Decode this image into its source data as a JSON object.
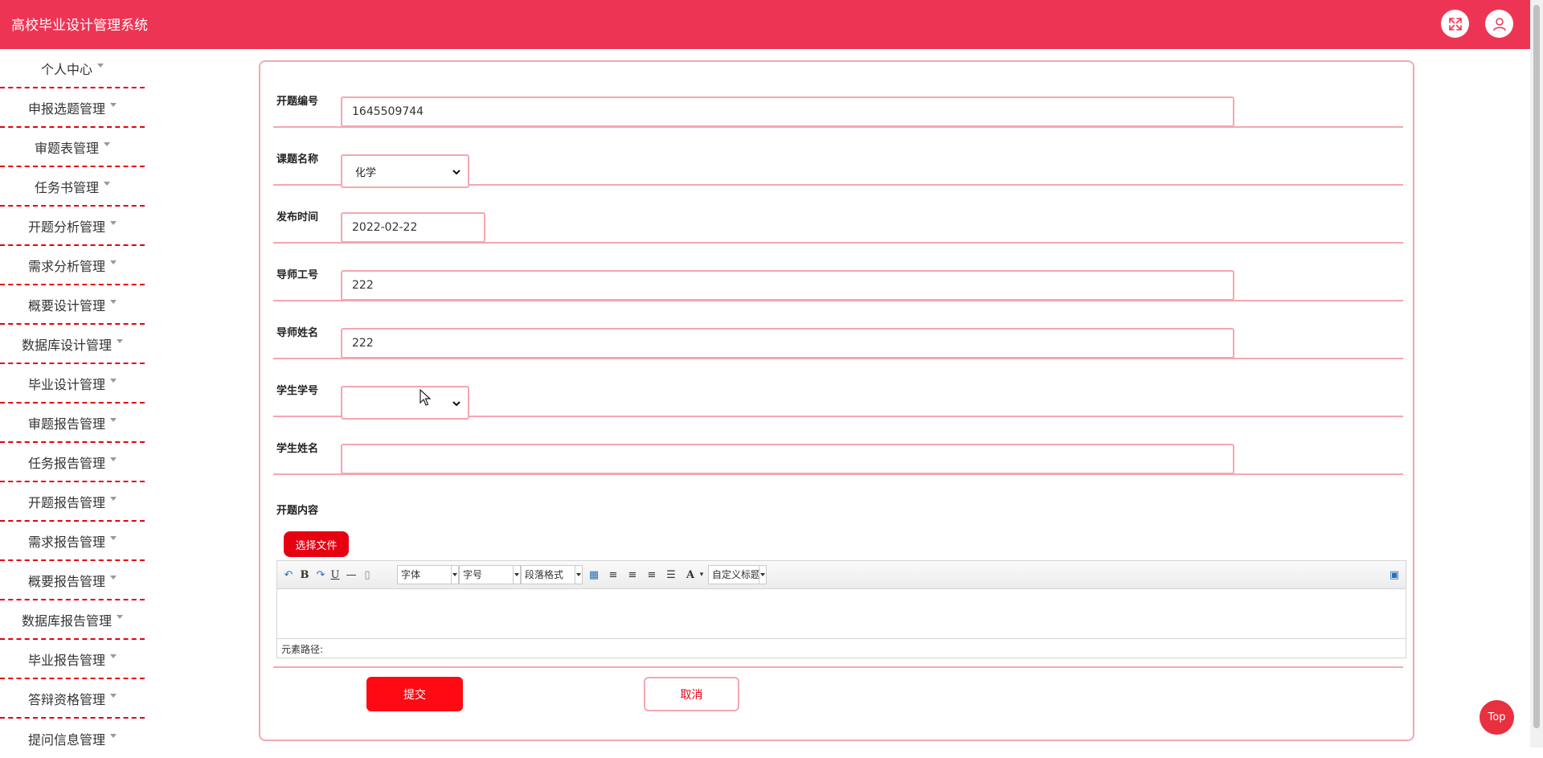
{
  "header": {
    "title": "高校毕业设计管理系统",
    "fullscreen_icon": "expand-icon",
    "user_icon": "user-icon"
  },
  "sidebar": {
    "items": [
      {
        "label": "个人中心"
      },
      {
        "label": "申报选题管理"
      },
      {
        "label": "审题表管理"
      },
      {
        "label": "任务书管理"
      },
      {
        "label": "开题分析管理"
      },
      {
        "label": "需求分析管理"
      },
      {
        "label": "概要设计管理"
      },
      {
        "label": "数据库设计管理"
      },
      {
        "label": "毕业设计管理"
      },
      {
        "label": "审题报告管理"
      },
      {
        "label": "任务报告管理"
      },
      {
        "label": "开题报告管理"
      },
      {
        "label": "需求报告管理"
      },
      {
        "label": "概要报告管理"
      },
      {
        "label": "数据库报告管理"
      },
      {
        "label": "毕业报告管理"
      },
      {
        "label": "答辩资格管理"
      },
      {
        "label": "提问信息管理"
      }
    ]
  },
  "form": {
    "fields": {
      "kaiti_no": {
        "label": "开题编号",
        "value": "1645509744"
      },
      "topic_name": {
        "label": "课题名称",
        "value": "化学"
      },
      "publish_time": {
        "label": "发布时间",
        "value": "2022-02-22"
      },
      "tutor_id": {
        "label": "导师工号",
        "value": "222"
      },
      "tutor_name": {
        "label": "导师姓名",
        "value": "222"
      },
      "student_id": {
        "label": "学生学号",
        "value": ""
      },
      "student_name": {
        "label": "学生姓名",
        "value": ""
      }
    },
    "content": {
      "label": "开题内容",
      "choose_file": "选择文件",
      "toolbar": {
        "font": "字体",
        "font_size": "字号",
        "paragraph": "段落格式",
        "custom_title": "自定义标题"
      },
      "element_path": "元素路径:"
    },
    "submit": "提交",
    "cancel": "取消"
  },
  "top_button": "Top",
  "colors": {
    "brand": "#ee3454",
    "accent_red": "#e60012",
    "border_pink": "#f4a7b0"
  }
}
